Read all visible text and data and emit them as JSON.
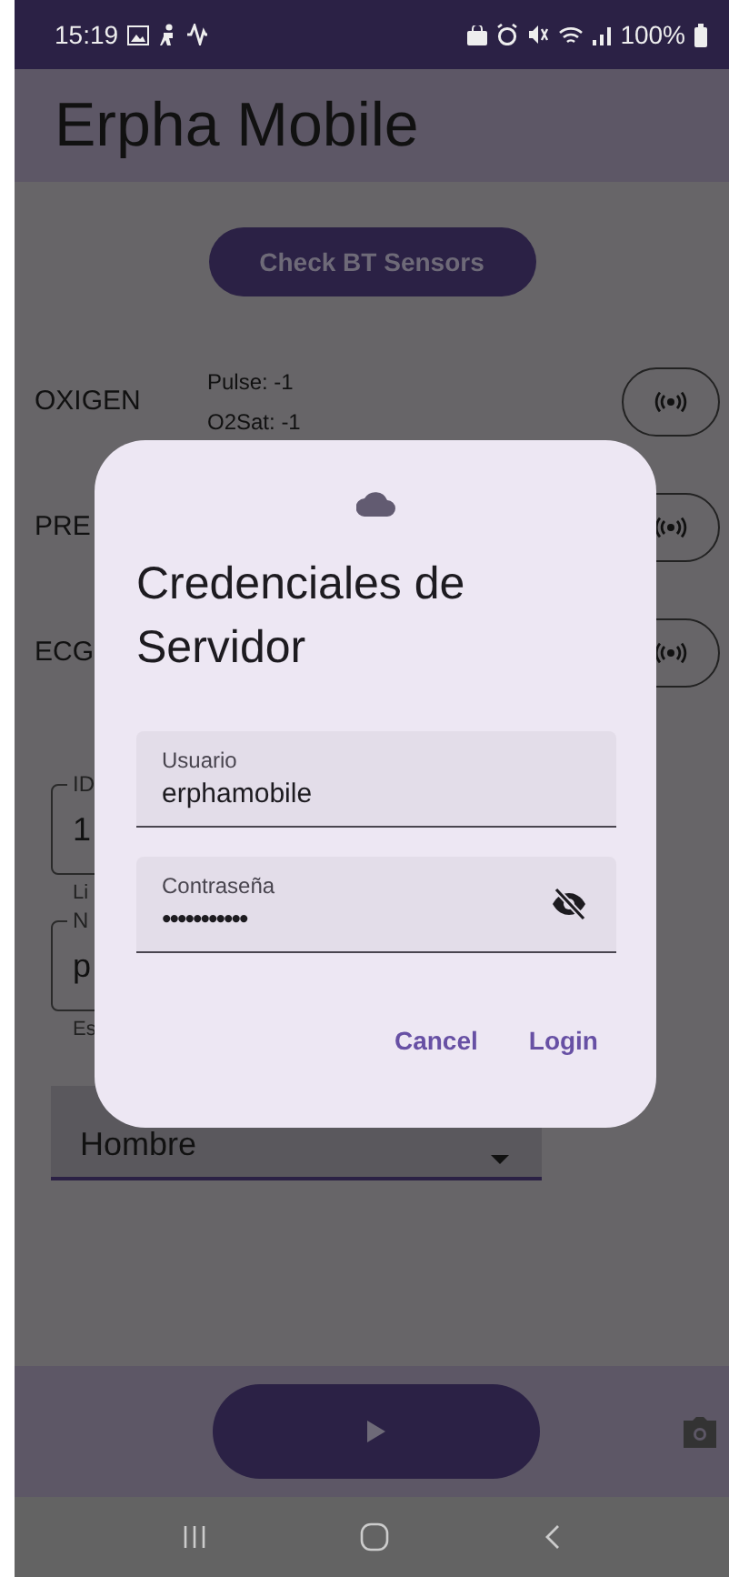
{
  "status_bar": {
    "time": "15:19",
    "battery": "100%"
  },
  "app_bar": {
    "title": "Erpha Mobile"
  },
  "check_button": {
    "label": "Check BT Sensors"
  },
  "sensors": [
    {
      "name": "OXIGEN",
      "readings": [
        "Pulse: -1",
        "O2Sat: -1"
      ]
    },
    {
      "name": "PRE"
    },
    {
      "name": "ECG"
    }
  ],
  "form": {
    "fields": [
      {
        "label": "ID",
        "value": "1",
        "helper": "Li"
      },
      {
        "label": "N",
        "value": "p",
        "helper": "Es"
      }
    ],
    "dropdown": {
      "value": "Hombre"
    }
  },
  "dialog": {
    "title": "Credenciales de Servidor",
    "fields": [
      {
        "kind": "text",
        "label": "Usuario",
        "value": "erphamobile"
      },
      {
        "kind": "password",
        "label": "Contraseña",
        "value": "•••••••••••"
      }
    ],
    "buttons": [
      "Cancel",
      "Login"
    ]
  }
}
